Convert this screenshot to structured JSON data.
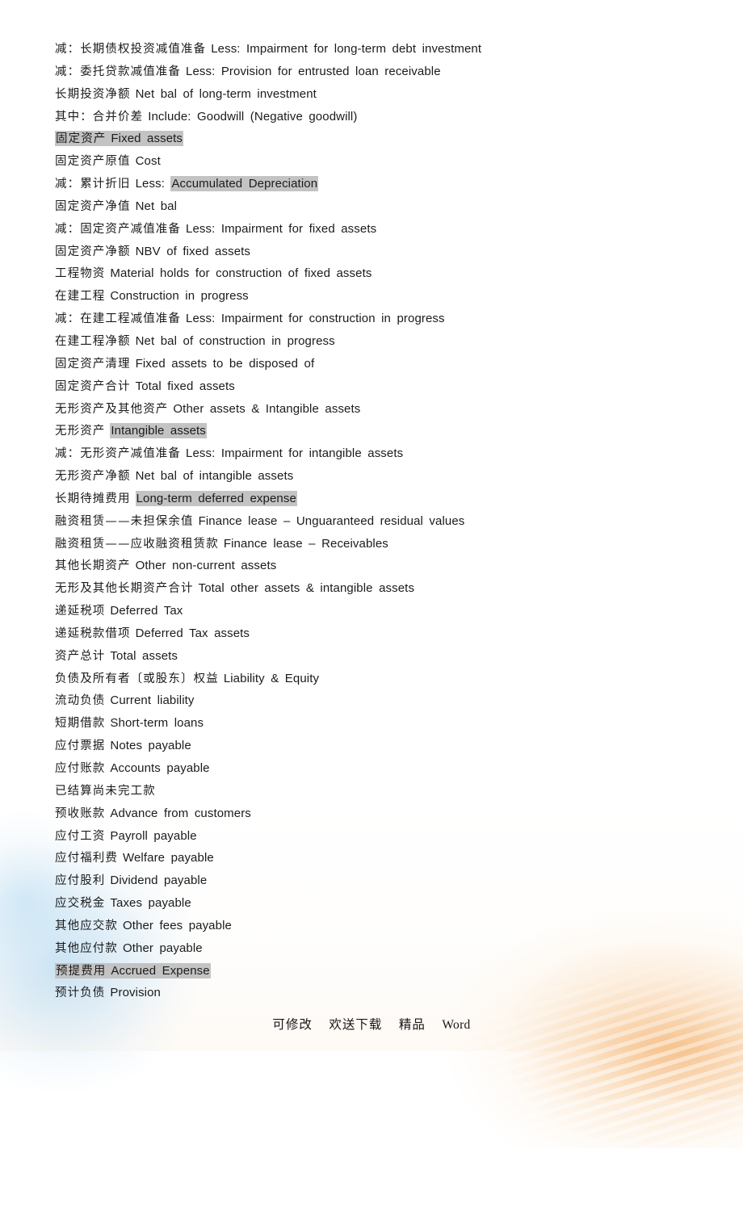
{
  "document": {
    "highlight_color": "#c3c3c3",
    "text_color": "#1b1b1b",
    "lines": [
      {
        "cn": "减：长期债权投资减值准备",
        "en": "Less: Impairment for long-term debt investment",
        "highlight": "none"
      },
      {
        "cn": "减：委托贷款减值准备",
        "en": "Less: Provision for entrusted loan receivable",
        "highlight": "none"
      },
      {
        "cn": "长期投资净额",
        "en": "Net bal of long-term investment",
        "highlight": "none"
      },
      {
        "cn": "其中：合并价差",
        "en": "Include: Goodwill (Negative goodwill)",
        "highlight": "none"
      },
      {
        "cn": "固定资产",
        "en": "Fixed assets",
        "highlight": "full"
      },
      {
        "cn": "固定资产原值",
        "en": "Cost",
        "highlight": "none"
      },
      {
        "cn": "减：累计折旧",
        "en": "Less: ",
        "en_highlight": "Accumulated Depreciation",
        "highlight": "partial"
      },
      {
        "cn": "固定资产净值",
        "en": "Net bal",
        "highlight": "none"
      },
      {
        "cn": "减：固定资产减值准备",
        "en": "Less: Impairment for fixed assets",
        "highlight": "none"
      },
      {
        "cn": "固定资产净额",
        "en": "NBV of fixed assets",
        "highlight": "none"
      },
      {
        "cn": "工程物资",
        "en": "Material holds for construction of fixed assets",
        "highlight": "none"
      },
      {
        "cn": "在建工程",
        "en": "Construction in progress",
        "highlight": "none"
      },
      {
        "cn": "减：在建工程减值准备",
        "en": "Less: Impairment for construction in progress",
        "highlight": "none"
      },
      {
        "cn": "在建工程净额",
        "en": "Net bal of construction in progress",
        "highlight": "none"
      },
      {
        "cn": "固定资产清理",
        "en": "Fixed assets to be disposed of",
        "highlight": "none"
      },
      {
        "cn": "固定资产合计",
        "en": "Total fixed assets",
        "highlight": "none"
      },
      {
        "cn": "无形资产及其他资产",
        "en": "Other assets & Intangible assets",
        "highlight": "none"
      },
      {
        "cn": "无形资产",
        "en": "",
        "en_highlight": "Intangible assets",
        "highlight": "english"
      },
      {
        "cn": "减：无形资产减值准备",
        "en": "Less: Impairment for intangible assets",
        "highlight": "none"
      },
      {
        "cn": "无形资产净额",
        "en": "Net bal of intangible assets",
        "highlight": "none"
      },
      {
        "cn": "长期待摊费用",
        "en": "",
        "en_highlight": "Long-term deferred expense",
        "highlight": "english"
      },
      {
        "cn": "融资租赁——未担保余值",
        "en": "Finance lease – Unguaranteed residual values",
        "highlight": "none"
      },
      {
        "cn": "融资租赁——应收融资租赁款",
        "en": "Finance lease – Receivables",
        "highlight": "none"
      },
      {
        "cn": "其他长期资产",
        "en": "Other non-current assets",
        "highlight": "none"
      },
      {
        "cn": "无形及其他长期资产合计",
        "en": "Total other assets & intangible assets",
        "highlight": "none"
      },
      {
        "cn": "递延税项",
        "en": "Deferred Tax",
        "highlight": "none"
      },
      {
        "cn": "递延税款借项",
        "en": "Deferred Tax assets",
        "highlight": "none"
      },
      {
        "cn": "资产总计",
        "en": "Total assets",
        "highlight": "none"
      },
      {
        "cn": "负债及所有者〔或股东〕权益",
        "en": "Liability & Equity",
        "highlight": "none"
      },
      {
        "cn": "流动负债",
        "en": "Current liability",
        "highlight": "none"
      },
      {
        "cn": "短期借款",
        "en": "Short-term loans",
        "highlight": "none"
      },
      {
        "cn": "应付票据",
        "en": "Notes payable",
        "highlight": "none"
      },
      {
        "cn": "应付账款",
        "en": "Accounts payable",
        "highlight": "none"
      },
      {
        "cn": "已结算尚未完工款",
        "en": "",
        "highlight": "none"
      },
      {
        "cn": "预收账款",
        "en": "Advance from customers",
        "highlight": "none"
      },
      {
        "cn": "应付工资",
        "en": "Payroll payable",
        "highlight": "none"
      },
      {
        "cn": "应付福利费",
        "en": "Welfare payable",
        "highlight": "none"
      },
      {
        "cn": "应付股利",
        "en": "Dividend payable",
        "highlight": "none"
      },
      {
        "cn": "应交税金",
        "en": "Taxes payable",
        "highlight": "none"
      },
      {
        "cn": "其他应交款",
        "en": "Other fees payable",
        "highlight": "none"
      },
      {
        "cn": "其他应付款",
        "en": "Other payable",
        "highlight": "none"
      },
      {
        "cn": "预提费用",
        "en": "Accrued Expense",
        "highlight": "full"
      },
      {
        "cn": "预计负债",
        "en": "Provision",
        "highlight": "none"
      }
    ]
  },
  "footer": {
    "items": [
      {
        "text": "可修改",
        "script": "cn"
      },
      {
        "text": "欢送下载",
        "script": "cn"
      },
      {
        "text": "精品",
        "script": "cn"
      },
      {
        "text": "Word",
        "script": "latin"
      }
    ]
  }
}
